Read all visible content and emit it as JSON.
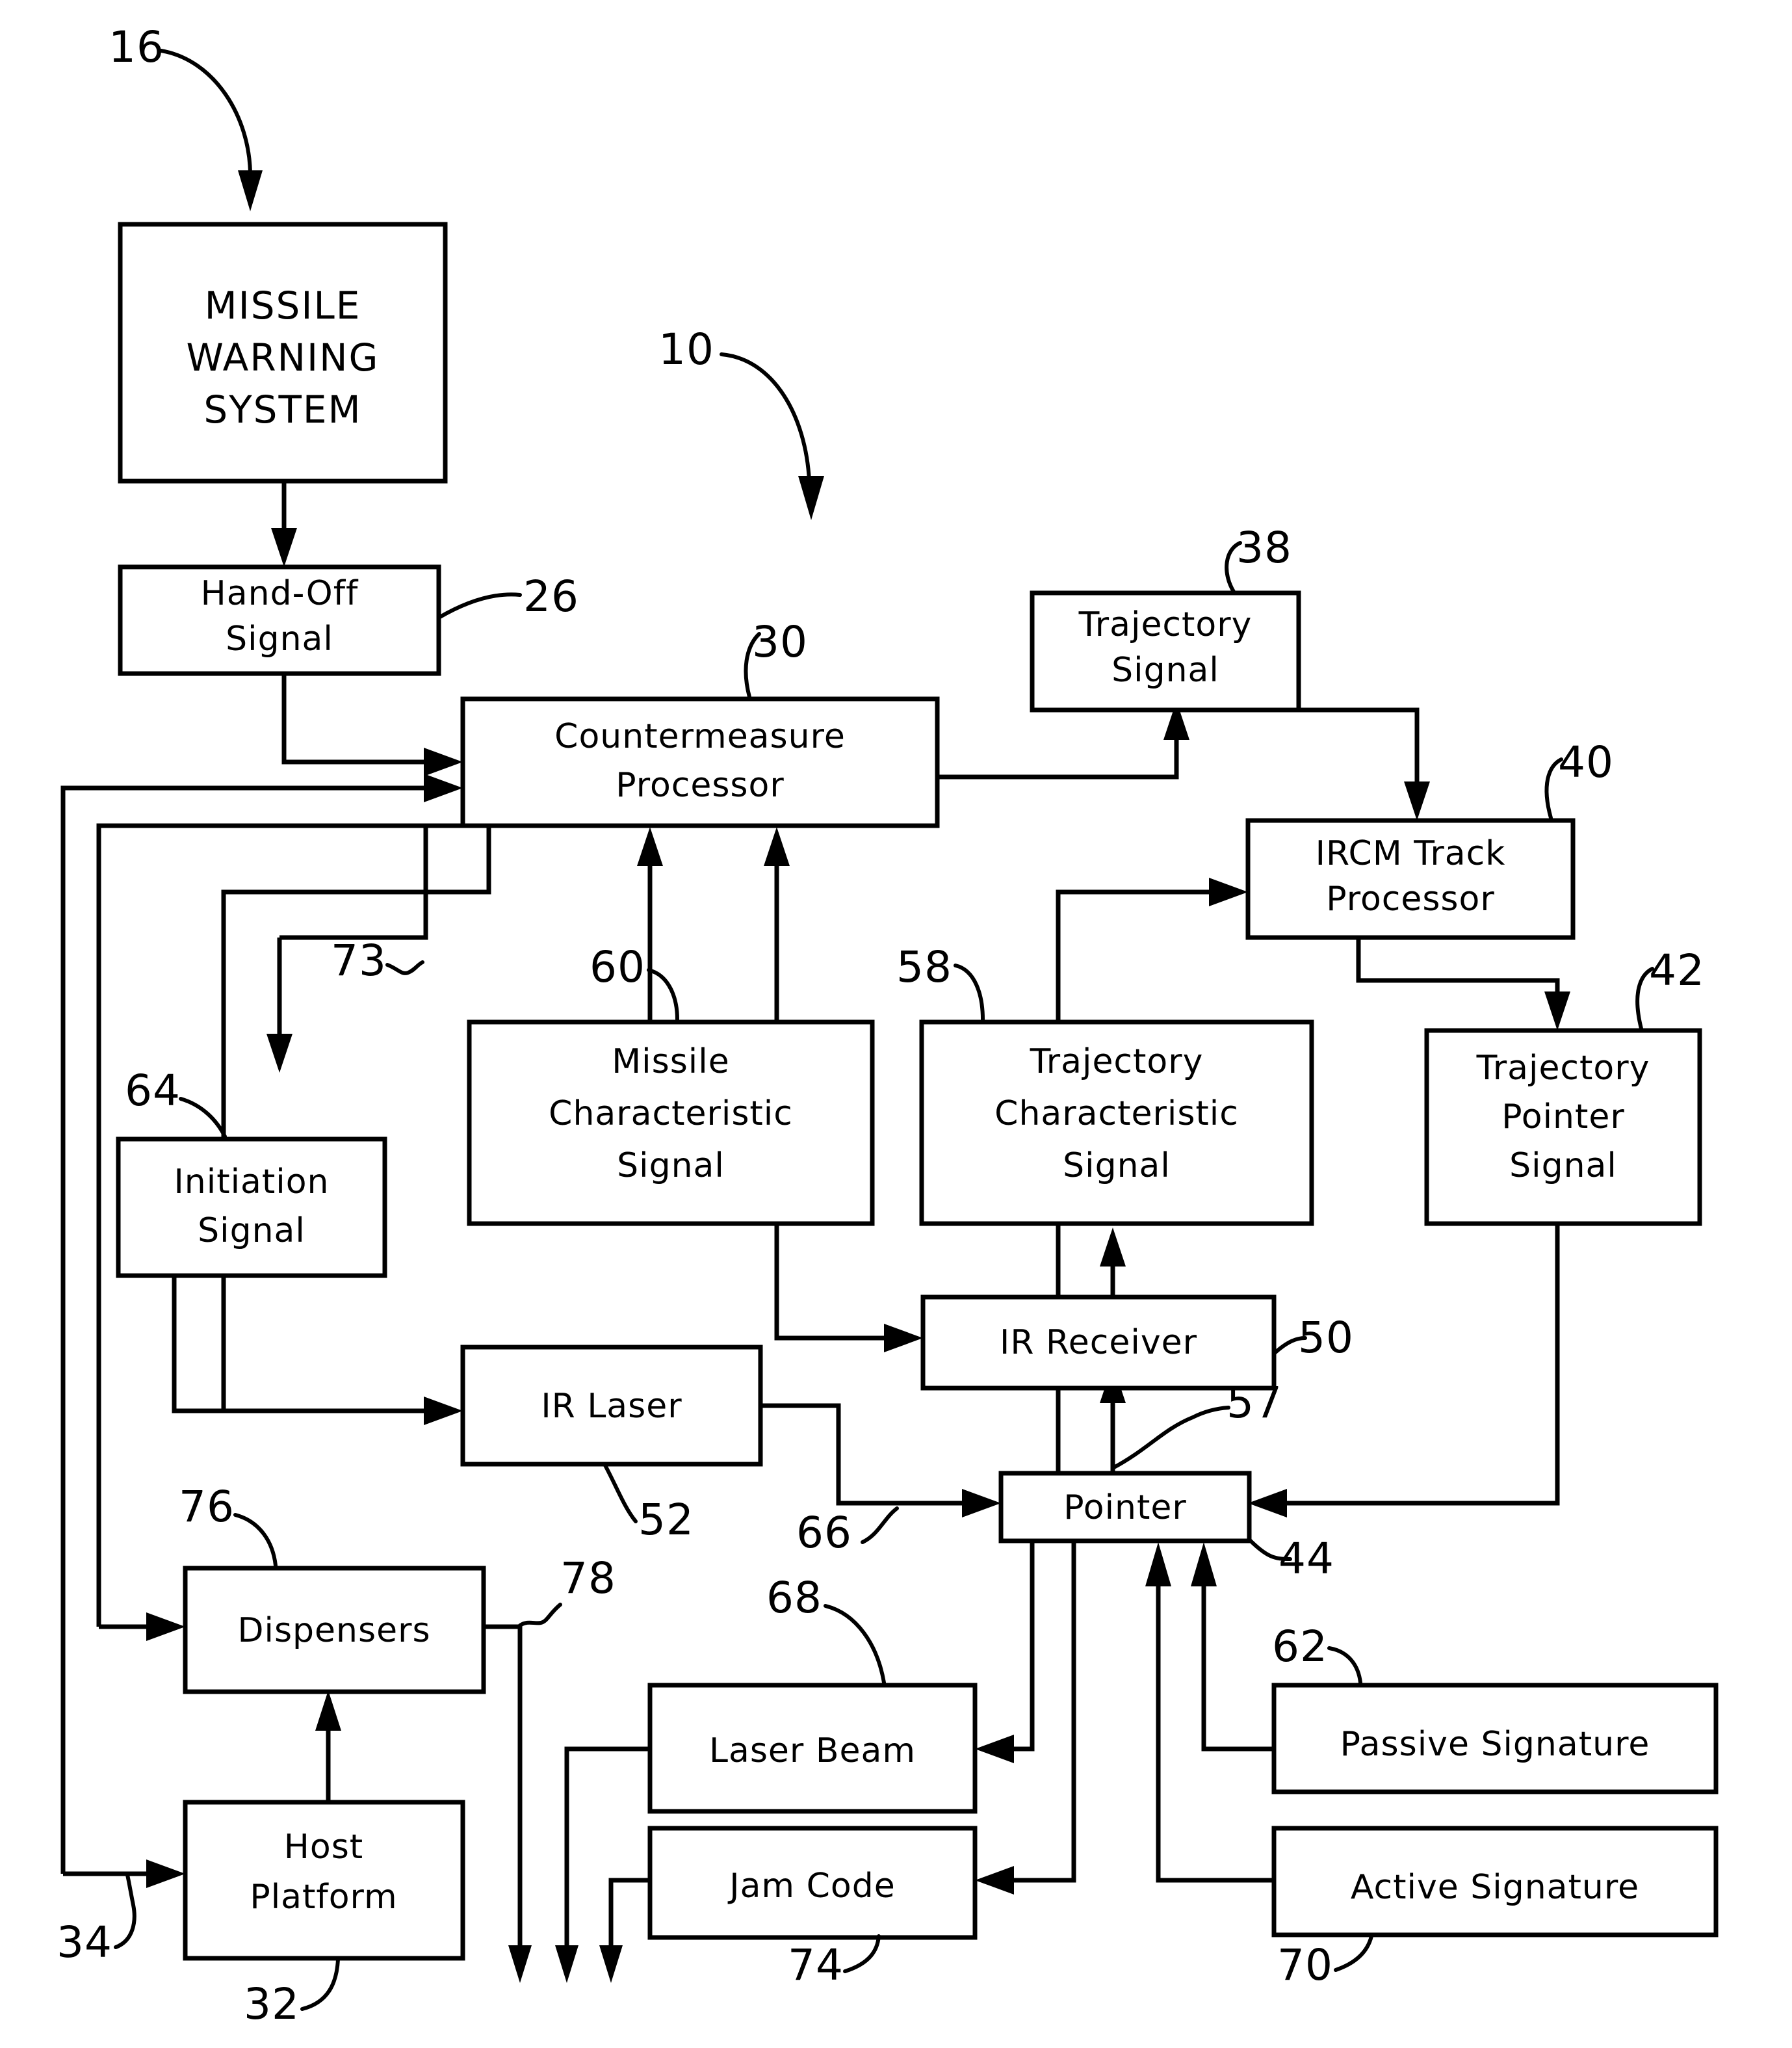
{
  "figure": {
    "type": "patent-block-diagram",
    "system_reference_numeral": "10"
  },
  "blocks": [
    {
      "id": "missile-warning-system",
      "ref": "16",
      "lines": [
        "MISSILE",
        "WARNING",
        "SYSTEM"
      ],
      "uppercase": true
    },
    {
      "id": "hand-off-signal",
      "ref": "26",
      "lines": [
        "Hand-Off",
        "Signal"
      ]
    },
    {
      "id": "countermeasure-processor",
      "ref": "30",
      "lines": [
        "Countermeasure",
        "Processor"
      ]
    },
    {
      "id": "trajectory-signal",
      "ref": "38",
      "lines": [
        "Trajectory",
        "Signal"
      ]
    },
    {
      "id": "ircm-track-processor",
      "ref": "40",
      "lines": [
        "IRCM Track",
        "Processor"
      ]
    },
    {
      "id": "missile-characteristic-signal",
      "ref": "60",
      "lines": [
        "Missile",
        "Characteristic",
        "Signal"
      ]
    },
    {
      "id": "trajectory-characteristic-signal",
      "ref": "58",
      "lines": [
        "Trajectory",
        "Characteristic",
        "Signal"
      ]
    },
    {
      "id": "trajectory-pointer-signal",
      "ref": "42",
      "lines": [
        "Trajectory",
        "Pointer",
        "Signal"
      ]
    },
    {
      "id": "initiation-signal",
      "ref": "64",
      "lines": [
        "Initiation",
        "Signal"
      ]
    },
    {
      "id": "ir-receiver",
      "ref": "50",
      "lines": [
        "IR Receiver"
      ]
    },
    {
      "id": "ir-laser",
      "ref": "52",
      "lines": [
        "IR Laser"
      ]
    },
    {
      "id": "pointer",
      "ref": "44",
      "lines": [
        "Pointer"
      ]
    },
    {
      "id": "dispensers",
      "ref": "76",
      "lines": [
        "Dispensers"
      ]
    },
    {
      "id": "host-platform",
      "ref": "32",
      "lines": [
        "Host",
        "Platform"
      ]
    },
    {
      "id": "laser-beam",
      "ref": "68",
      "lines": [
        "Laser Beam"
      ]
    },
    {
      "id": "jam-code",
      "ref": "74",
      "lines": [
        "Jam Code"
      ]
    },
    {
      "id": "passive-signature",
      "ref": "62",
      "lines": [
        "Passive  Signature"
      ]
    },
    {
      "id": "active-signature",
      "ref": "70",
      "lines": [
        "Active  Signature"
      ]
    }
  ],
  "labels": {
    "b_mws_l1": "MISSILE",
    "b_mws_l2": "WARNING",
    "b_mws_l3": "SYSTEM",
    "b_handoff_l1": "Hand-Off",
    "b_handoff_l2": "Signal",
    "b_cmp_l1": "Countermeasure",
    "b_cmp_l2": "Processor",
    "b_trajsig_l1": "Trajectory",
    "b_trajsig_l2": "Signal",
    "b_ircm_l1": "IRCM Track",
    "b_ircm_l2": "Processor",
    "b_misschar_l1": "Missile",
    "b_misschar_l2": "Characteristic",
    "b_misschar_l3": "Signal",
    "b_trajchar_l1": "Trajectory",
    "b_trajchar_l2": "Characteristic",
    "b_trajchar_l3": "Signal",
    "b_trajptr_l1": "Trajectory",
    "b_trajptr_l2": "Pointer",
    "b_trajptr_l3": "Signal",
    "b_init_l1": "Initiation",
    "b_init_l2": "Signal",
    "b_irrecv_l1": "IR Receiver",
    "b_irlaser_l1": "IR Laser",
    "b_pointer_l1": "Pointer",
    "b_disp_l1": "Dispensers",
    "b_host_l1": "Host",
    "b_host_l2": "Platform",
    "b_laserbeam_l1": "Laser Beam",
    "b_jamcode_l1": "Jam Code",
    "b_passive_l1": "Passive  Signature",
    "b_active_l1": "Active  Signature"
  },
  "reference_numerals": {
    "n10": "10",
    "n16": "16",
    "n26": "26",
    "n30": "30",
    "n32": "32",
    "n34": "34",
    "n38": "38",
    "n40": "40",
    "n42": "42",
    "n44": "44",
    "n50": "50",
    "n52": "52",
    "n57": "57",
    "n58": "58",
    "n60": "60",
    "n62": "62",
    "n64": "64",
    "n66": "66",
    "n68": "68",
    "n70": "70",
    "n73": "73",
    "n74": "74",
    "n76": "76",
    "n78": "78"
  },
  "colors": {
    "ink": "#000000",
    "paper": "#ffffff"
  }
}
